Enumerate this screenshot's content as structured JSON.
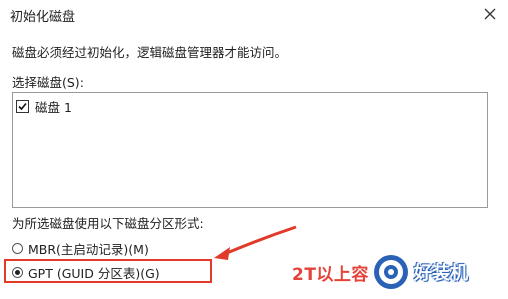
{
  "window": {
    "title": "初始化磁盘",
    "close_icon": "close-icon"
  },
  "content": {
    "description": "磁盘必须经过初始化，逻辑磁盘管理器才能访问。",
    "select_label": "选择磁盘(S):",
    "disks": [
      {
        "label": "磁盘 1",
        "checked": true
      }
    ],
    "partition_style_label": "为所选磁盘使用以下磁盘分区形式:",
    "options": {
      "mbr": {
        "label": "MBR(主启动记录)(M)",
        "selected": false
      },
      "gpt": {
        "label": "GPT (GUID 分区表)(G)",
        "selected": true
      }
    }
  },
  "annotation": {
    "text": "2T以上容",
    "color": "#e23a2a"
  },
  "watermark": {
    "text": "好装机",
    "logo_icon": "watermark-logo"
  }
}
